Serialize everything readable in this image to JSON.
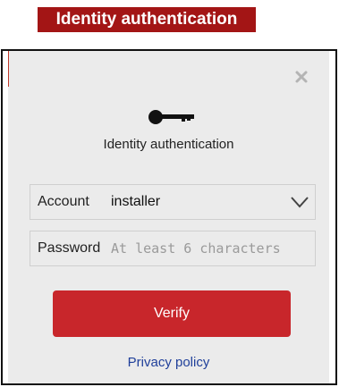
{
  "banner": {
    "title": "Identity authentication"
  },
  "dialog": {
    "close_icon": "close-icon",
    "key_icon": "key-icon",
    "heading": "Identity authentication",
    "account": {
      "label": "Account",
      "value": "installer",
      "dropdown_icon": "chevron-down-icon"
    },
    "password": {
      "label": "Password",
      "value": "",
      "placeholder": "At least 6 characters"
    },
    "verify_label": "Verify",
    "privacy_label": "Privacy policy"
  },
  "colors": {
    "banner_bg": "#a31515",
    "button_bg": "#c8262b",
    "link": "#1f3f9a",
    "dialog_bg": "#ebebeb"
  }
}
